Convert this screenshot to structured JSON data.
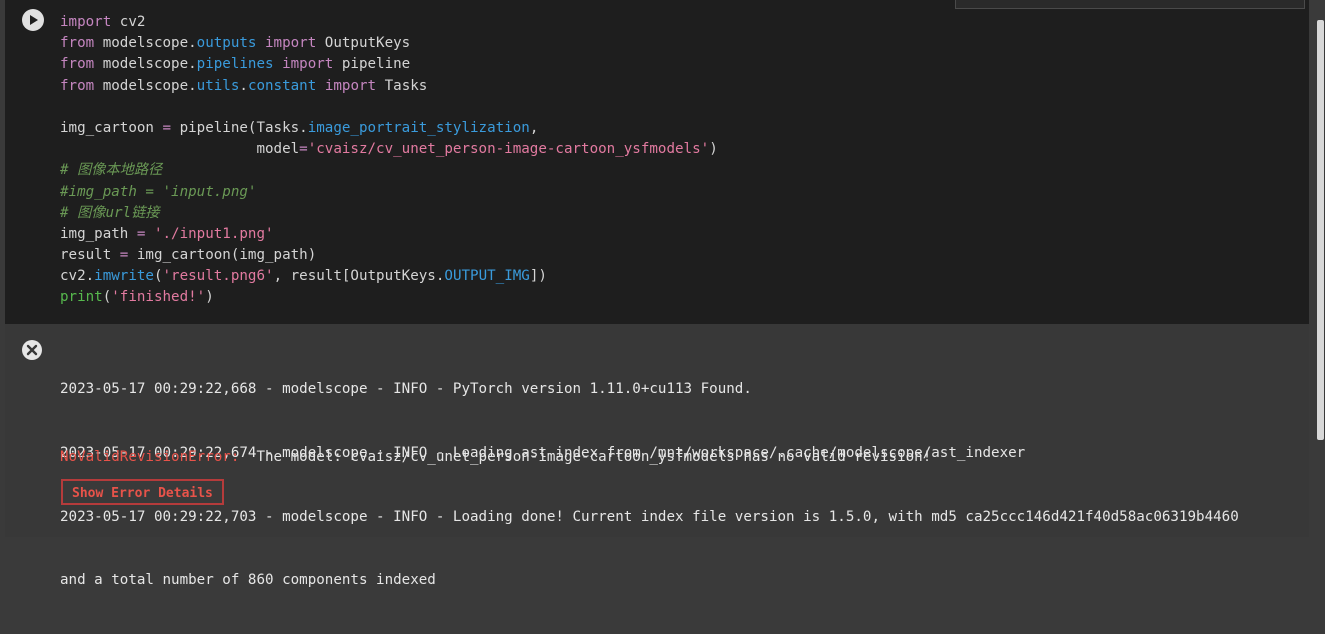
{
  "code_lines": [
    [
      {
        "t": "import",
        "c": "kw2"
      },
      {
        "t": " cv2",
        "c": ""
      }
    ],
    [
      {
        "t": "from",
        "c": "kw2"
      },
      {
        "t": " modelscope.",
        "c": ""
      },
      {
        "t": "outputs",
        "c": "attr"
      },
      {
        "t": " ",
        "c": ""
      },
      {
        "t": "import",
        "c": "kw2"
      },
      {
        "t": " OutputKeys",
        "c": ""
      }
    ],
    [
      {
        "t": "from",
        "c": "kw2"
      },
      {
        "t": " modelscope.",
        "c": ""
      },
      {
        "t": "pipelines",
        "c": "attr"
      },
      {
        "t": " ",
        "c": ""
      },
      {
        "t": "import",
        "c": "kw2"
      },
      {
        "t": " pipeline",
        "c": ""
      }
    ],
    [
      {
        "t": "from",
        "c": "kw2"
      },
      {
        "t": " modelscope.",
        "c": ""
      },
      {
        "t": "utils",
        "c": "attr"
      },
      {
        "t": ".",
        "c": ""
      },
      {
        "t": "constant",
        "c": "attr"
      },
      {
        "t": " ",
        "c": ""
      },
      {
        "t": "import",
        "c": "kw2"
      },
      {
        "t": " Tasks",
        "c": ""
      }
    ],
    [],
    [
      {
        "t": "img_cartoon ",
        "c": ""
      },
      {
        "t": "=",
        "c": "kw2"
      },
      {
        "t": " pipeline(Tasks.",
        "c": ""
      },
      {
        "t": "image_portrait_stylization",
        "c": "attr"
      },
      {
        "t": ",",
        "c": ""
      }
    ],
    [
      {
        "t": "                       model",
        "c": ""
      },
      {
        "t": "=",
        "c": "kw2"
      },
      {
        "t": "'cvaisz/cv_unet_person-image-cartoon_ysfmodels'",
        "c": "str"
      },
      {
        "t": ")",
        "c": ""
      }
    ],
    [
      {
        "t": "# 图像本地路径",
        "c": "cm"
      }
    ],
    [
      {
        "t": "#img_path = 'input.png'",
        "c": "cm"
      }
    ],
    [
      {
        "t": "# 图像url链接",
        "c": "cm"
      }
    ],
    [
      {
        "t": "img_path ",
        "c": ""
      },
      {
        "t": "=",
        "c": "kw2"
      },
      {
        "t": " ",
        "c": ""
      },
      {
        "t": "'./input1.png'",
        "c": "str"
      }
    ],
    [
      {
        "t": "result ",
        "c": ""
      },
      {
        "t": "=",
        "c": "kw2"
      },
      {
        "t": " img_cartoon(img_path)",
        "c": ""
      }
    ],
    [
      {
        "t": "cv2.",
        "c": ""
      },
      {
        "t": "imwrite",
        "c": "attr"
      },
      {
        "t": "(",
        "c": ""
      },
      {
        "t": "'result.png6'",
        "c": "str"
      },
      {
        "t": ", result[OutputKeys.",
        "c": ""
      },
      {
        "t": "OUTPUT_IMG",
        "c": "attr"
      },
      {
        "t": "])",
        "c": ""
      }
    ],
    [
      {
        "t": "print",
        "c": "fn"
      },
      {
        "t": "(",
        "c": ""
      },
      {
        "t": "'finished!'",
        "c": "str"
      },
      {
        "t": ")",
        "c": ""
      }
    ]
  ],
  "output": {
    "log_lines": [
      "2023-05-17 00:29:22,668 - modelscope - INFO - PyTorch version 1.11.0+cu113 Found.",
      "2023-05-17 00:29:22,674 - modelscope - INFO - Loading ast index from /mnt/workspace/.cache/modelscope/ast_indexer",
      "2023-05-17 00:29:22,703 - modelscope - INFO - Loading done! Current index file version is 1.5.0, with md5 ca25ccc146d421f40d58ac06319b4460",
      "and a total number of 860 components indexed"
    ],
    "error_name": "NoValidRevisionError:",
    "error_message": "  The model: cvaisz/cv_unet_person-image-cartoon_ysfmodels has no valid revision!",
    "error_button_label": "Show  Error Details"
  },
  "colors": {
    "keyword": "#c586c0",
    "attribute": "#3a9bdc",
    "string": "#e27aa0",
    "comment": "#6a9955",
    "error": "#e8534a"
  },
  "icons": {
    "run": "play-icon",
    "output_status": "error-x-icon"
  }
}
